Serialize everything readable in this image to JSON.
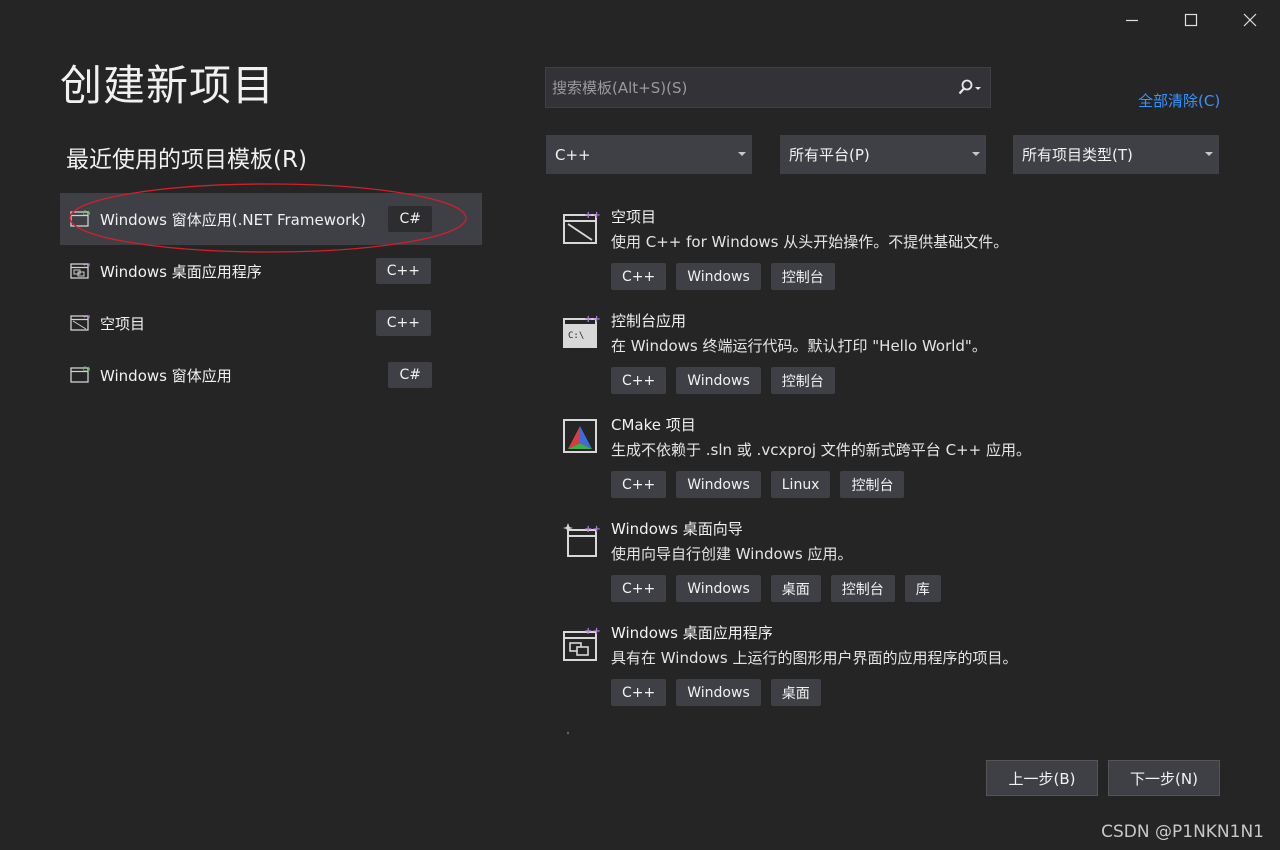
{
  "window": {
    "title": "创建新项目",
    "controls": [
      "minimize-icon",
      "maximize-icon",
      "close-icon"
    ]
  },
  "recent": {
    "heading": "最近使用的项目模板(R)",
    "items": [
      {
        "name": "Windows 窗体应用(.NET Framework)",
        "lang": "C#",
        "icon": "winforms-app-icon",
        "selected": true
      },
      {
        "name": "Windows 桌面应用程序",
        "lang": "C++",
        "icon": "desktop-app-icon",
        "selected": false
      },
      {
        "name": "空项目",
        "lang": "C++",
        "icon": "empty-project-icon",
        "selected": false
      },
      {
        "name": "Windows 窗体应用",
        "lang": "C#",
        "icon": "winforms-app-icon",
        "selected": false
      }
    ]
  },
  "search": {
    "placeholder": "搜索模板(Alt+S)(S)",
    "clear_all": "全部清除(C)"
  },
  "filters": {
    "language": "C++",
    "platform": "所有平台(P)",
    "project_type": "所有项目类型(T)"
  },
  "templates": [
    {
      "name": "空项目",
      "description": "使用 C++ for Windows 从头开始操作。不提供基础文件。",
      "tags": [
        "C++",
        "Windows",
        "控制台"
      ],
      "icon": "empty-project-icon"
    },
    {
      "name": "控制台应用",
      "description": "在 Windows 终端运行代码。默认打印 \"Hello World\"。",
      "tags": [
        "C++",
        "Windows",
        "控制台"
      ],
      "icon": "console-app-icon"
    },
    {
      "name": "CMake 项目",
      "description": "生成不依赖于 .sln 或 .vcxproj 文件的新式跨平台 C++ 应用。",
      "tags": [
        "C++",
        "Windows",
        "Linux",
        "控制台"
      ],
      "icon": "cmake-icon"
    },
    {
      "name": "Windows 桌面向导",
      "description": "使用向导自行创建 Windows 应用。",
      "tags": [
        "C++",
        "Windows",
        "桌面",
        "控制台",
        "库"
      ],
      "icon": "desktop-wizard-icon"
    },
    {
      "name": "Windows 桌面应用程序",
      "description": "具有在 Windows 上运行的图形用户界面的应用程序的项目。",
      "tags": [
        "C++",
        "Windows",
        "桌面"
      ],
      "icon": "desktop-app-icon"
    }
  ],
  "buttons": {
    "back": "上一步(B)",
    "next": "下一步(N)"
  },
  "watermark": "CSDN @P1NKN1N1",
  "colors": {
    "background": "#252526",
    "panel": "#3f3f46",
    "link": "#3794ff",
    "accent_purple": "#b180d7",
    "annotation_red": "#d0202a"
  }
}
